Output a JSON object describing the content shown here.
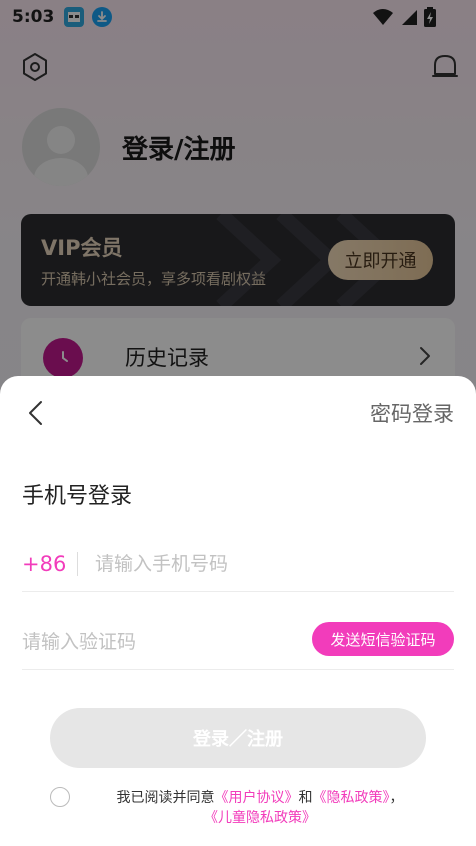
{
  "status_bar": {
    "time": "5:03"
  },
  "background": {
    "login_title": "登录/注册",
    "vip": {
      "title": "VIP会员",
      "subtitle": "开通韩小社会员，享多项看剧权益",
      "button_label": "立即开通"
    },
    "history": {
      "label": "历史记录"
    }
  },
  "sheet": {
    "password_login_label": "密码登录",
    "heading": "手机号登录",
    "phone": {
      "country_code": "+86",
      "placeholder": "请输入手机号码",
      "value": ""
    },
    "code": {
      "placeholder": "请输入验证码",
      "value": "",
      "send_button_label": "发送短信验证码"
    },
    "submit_label": "登录／注册",
    "agreement": {
      "prefix": "我已阅读并同意",
      "user_agreement": "《用户协议》",
      "and": "和",
      "privacy_policy": "《隐私政策》",
      "comma": "，",
      "child_privacy_policy": "《儿童隐私政策》",
      "checked": false
    }
  },
  "colors": {
    "accent": "#f23cbb",
    "vip_bg": "#2c2c30",
    "vip_gold": "#e8d6bd",
    "disabled_button": "#e6e6e6",
    "history_icon": "#c2188f"
  },
  "icons": [
    "news-app-icon",
    "download-icon",
    "wifi-icon",
    "signal-icon",
    "battery-icon",
    "settings-icon",
    "message-icon",
    "clock-icon",
    "chevron-right-icon",
    "back-arrow-icon"
  ]
}
